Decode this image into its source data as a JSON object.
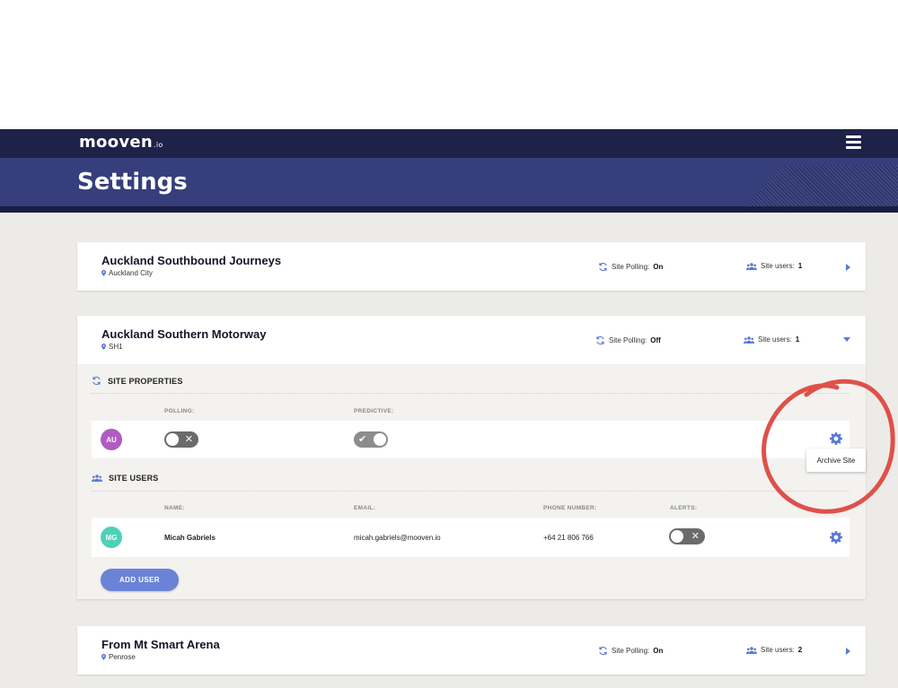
{
  "header": {
    "logo": "mooven",
    "logo_suffix": ".io",
    "menu_icon": "hamburger-menu-icon",
    "page_title": "Settings",
    "colors": {
      "nav": "#1e2248",
      "banner": "#363f7c",
      "accent": "#6a83d6",
      "background": "#ecebe7"
    }
  },
  "sites": [
    {
      "title": "Auckland Southbound Journeys",
      "location": "Auckland City",
      "polling_label": "Site Polling:",
      "polling_value": "On",
      "users_label": "Site users:",
      "users_value": "1",
      "expanded": false
    },
    {
      "title": "Auckland Southern Motorway",
      "location": "SH1",
      "polling_label": "Site Polling:",
      "polling_value": "Off",
      "users_label": "Site users:",
      "users_value": "1",
      "expanded": true
    },
    {
      "title": "From Mt Smart Arena",
      "location": "Penrose",
      "polling_label": "Site Polling:",
      "polling_value": "On",
      "users_label": "Site users:",
      "users_value": "2",
      "expanded": false
    }
  ],
  "site_properties": {
    "heading": "SITE PROPERTIES",
    "polling_col": "POLLING:",
    "predictive_col": "PREDICTIVE:",
    "avatar": "AU",
    "avatar_color": "#b15bc2",
    "polling_on": false,
    "predictive_on": true
  },
  "site_users": {
    "heading": "SITE USERS",
    "columns": {
      "name": "NAME:",
      "email": "EMAIL:",
      "phone": "PHONE NUMBER:",
      "alerts": "ALERTS:"
    },
    "rows": [
      {
        "avatar": "MG",
        "avatar_color": "#4fd1b8",
        "name": "Micah Gabriels",
        "email": "micah.gabriels@mooven.io",
        "phone": "+64 21 806 766",
        "alerts_on": false
      }
    ],
    "add_user_label": "ADD USER"
  },
  "tooltip": {
    "label": "Archive Site"
  },
  "annotation": {
    "color": "#e0504a"
  }
}
